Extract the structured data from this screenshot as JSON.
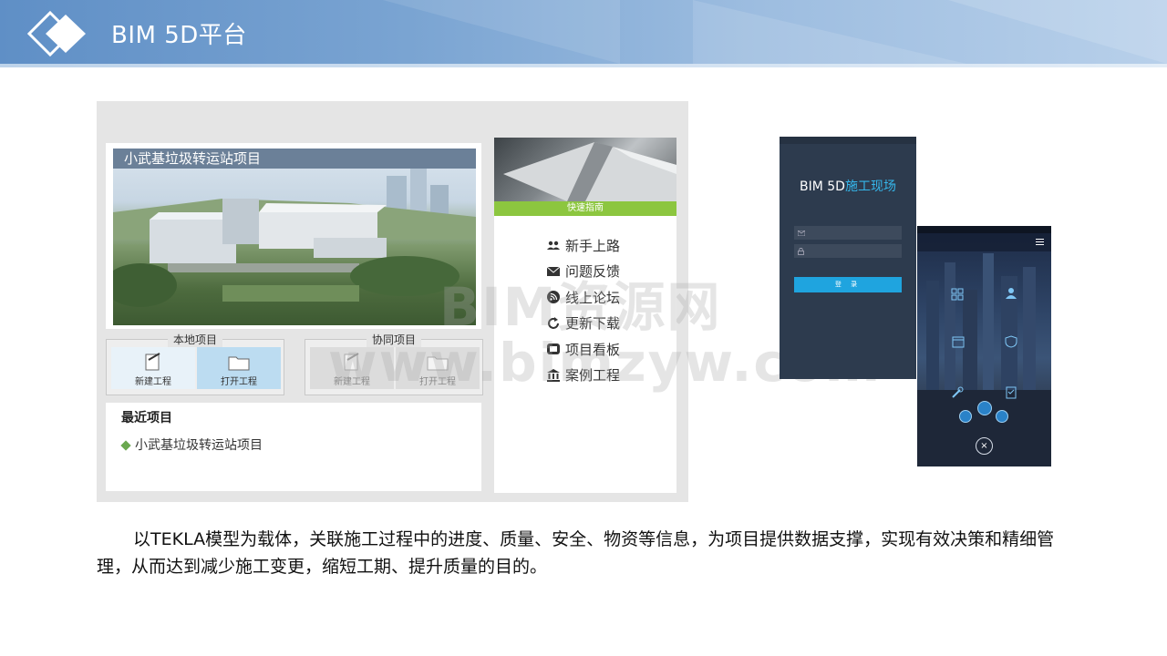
{
  "slide": {
    "title": "BIM 5D平台",
    "description": "以TEKLA模型为载体，关联施工过程中的进度、质量、安全、物资等信息，为项目提供数据支撑，实现有效决策和精细管理，从而达到减少施工变更，缩短工期、提升质量的目的。"
  },
  "desktop_app": {
    "project_caption": "小武基垃圾转运站项目",
    "local_panel": {
      "label": "本地项目",
      "new_label": "新建工程",
      "open_label": "打开工程"
    },
    "collab_panel": {
      "label": "协同项目",
      "new_label": "新建工程",
      "open_label": "打开工程"
    },
    "recent": {
      "title": "最近项目",
      "item": "小武基垃圾转运站项目"
    },
    "guide": {
      "bar_label": "快速指南",
      "items": [
        {
          "icon": "users-icon",
          "label": "新手上路"
        },
        {
          "icon": "envelope-icon",
          "label": "问题反馈"
        },
        {
          "icon": "rss-icon",
          "label": "线上论坛"
        },
        {
          "icon": "refresh-icon",
          "label": "更新下载"
        },
        {
          "icon": "board-icon",
          "label": "项目看板"
        },
        {
          "icon": "bank-icon",
          "label": "案例工程"
        }
      ]
    }
  },
  "watermark": {
    "line1": "BIM资源网",
    "line2": "www.bimzyw.com"
  },
  "mobile_login": {
    "title_prefix": "BIM 5D",
    "title_accent": "施工现场",
    "login_button": "登 录"
  },
  "mobile_home": {
    "close_glyph": "×"
  },
  "colors": {
    "header_blue": "#5f8fc6",
    "guide_green": "#8cc63f",
    "login_blue": "#1fa4df",
    "phone_bg": "#2d3b4e"
  }
}
